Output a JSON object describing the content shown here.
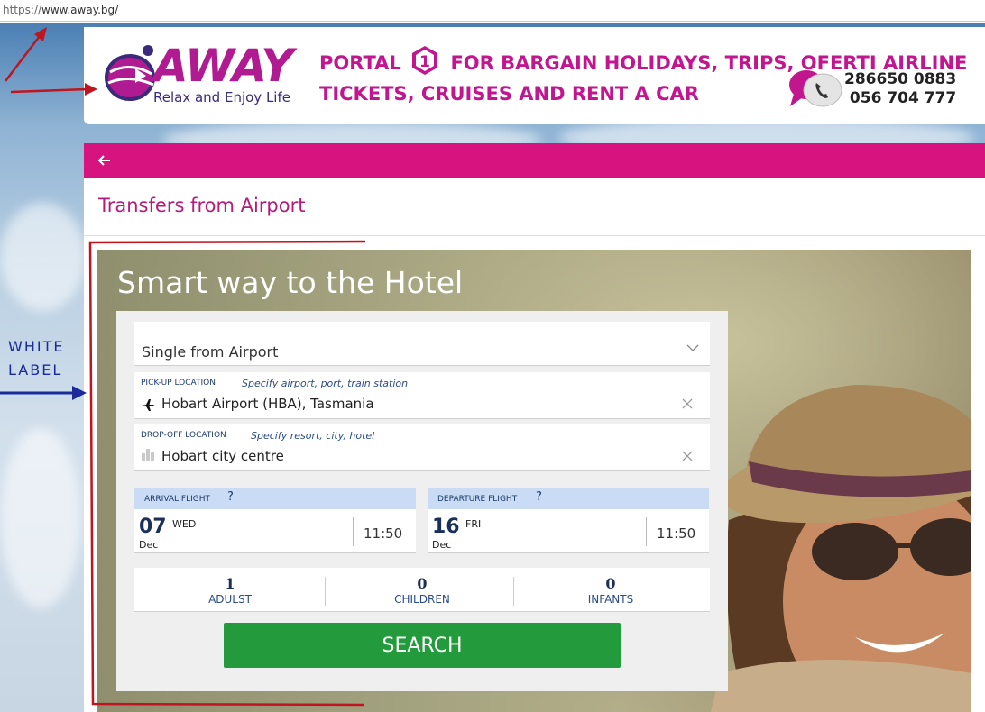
{
  "browser": {
    "url_scheme": "https://",
    "url_host": "www.away.bg/"
  },
  "header": {
    "logo_text": "AWAY",
    "logo_tagline": "Relax and Enjoy Life",
    "headline_part1": "PORTAL",
    "headline_number": "1",
    "headline_part2": "FOR BARGAIN HOLIDAYS, TRIPS, OFERTI AIRLINE TICKETS, CRUISES AND RENT A CAR",
    "phone_1": "286650 0883",
    "phone_2": "056 704 777",
    "brand_color": "#c2168f"
  },
  "nav": {
    "back_icon": "arrow-left-icon",
    "bar_color": "#d6137f"
  },
  "page": {
    "title": "Transfers from Airport"
  },
  "hero": {
    "title": "Smart way to the Hotel"
  },
  "form": {
    "trip_type": "Single from Airport",
    "pickup": {
      "label": "PICK-UP LOCATION",
      "hint": "Specify airport, port, train station",
      "value": "Hobart Airport (HBA), Tasmania",
      "icon": "airplane-icon"
    },
    "dropoff": {
      "label": "DROP-OFF LOCATION",
      "hint": "Specify resort, city, hotel",
      "value": "Hobart city centre",
      "icon": "hotel-icon"
    },
    "arrival": {
      "label": "ARRIVAL FLIGHT",
      "help": "?",
      "day": "07",
      "weekday": "WED",
      "month": "Dec",
      "time": "11:50"
    },
    "departure": {
      "label": "DEPARTURE FLIGHT",
      "help": "?",
      "day": "16",
      "weekday": "FRI",
      "month": "Dec",
      "time": "11:50"
    },
    "passengers": [
      {
        "count": "1",
        "label": "ADULST"
      },
      {
        "count": "0",
        "label": "CHILDREN"
      },
      {
        "count": "0",
        "label": "INFANTS"
      }
    ],
    "search_label": "SEARCH",
    "search_color": "#239a3b"
  },
  "annotation": {
    "line1": "WHITE",
    "line2": "LABEL",
    "arrow_color": "#1a2a9a",
    "frame_color": "#c0141e"
  }
}
